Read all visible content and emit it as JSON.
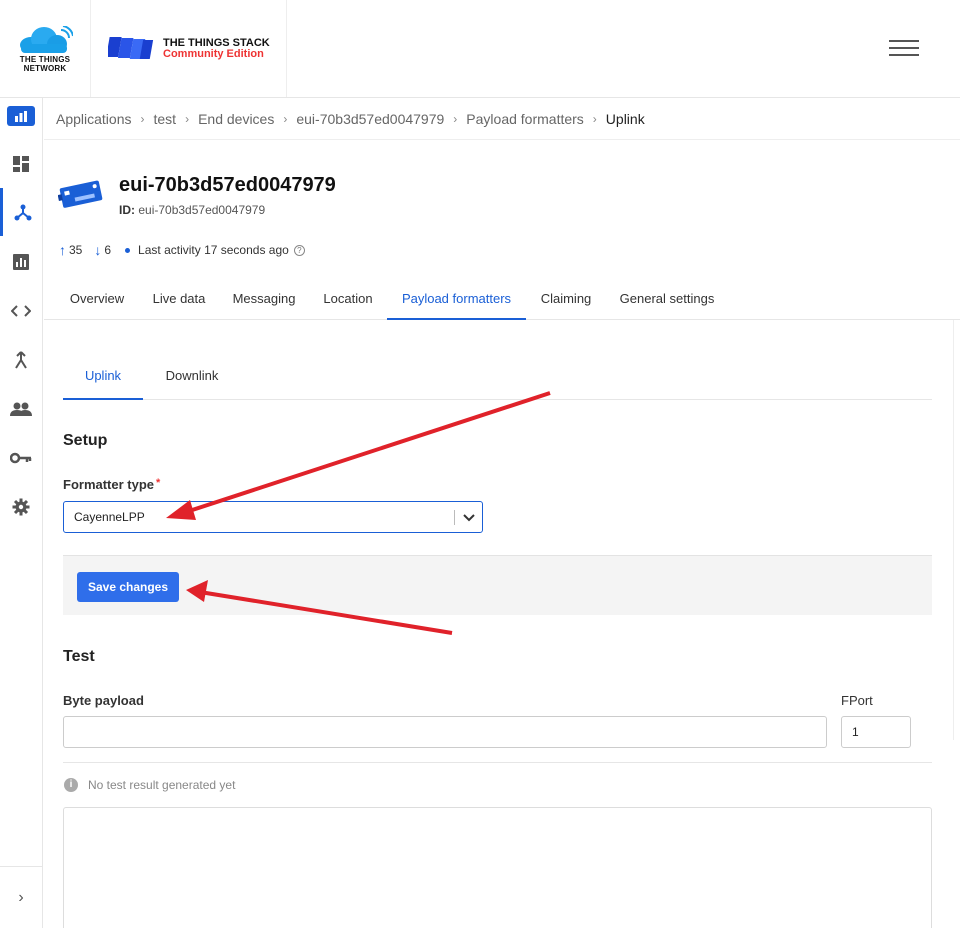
{
  "header": {
    "ttn_logo_text": [
      "THE THINGS",
      "NETWORK"
    ],
    "product_title": "THE THINGS STACK",
    "product_edition": "Community Edition"
  },
  "sidebar": {
    "items": [
      {
        "icon": "dashboard-icon"
      },
      {
        "icon": "applications-icon",
        "active": true
      },
      {
        "icon": "chart-icon"
      },
      {
        "icon": "code-icon"
      },
      {
        "icon": "merge-icon"
      },
      {
        "icon": "people-icon"
      },
      {
        "icon": "key-icon"
      },
      {
        "icon": "gear-icon"
      }
    ],
    "collapse_label": "›"
  },
  "breadcrumb": [
    "Applications",
    "test",
    "End devices",
    "eui-70b3d57ed0047979",
    "Payload formatters",
    "Uplink"
  ],
  "device": {
    "title": "eui-70b3d57ed0047979",
    "id_label": "ID:",
    "id_value": "eui-70b3d57ed0047979",
    "uplink_count": "35",
    "downlink_count": "6",
    "last_activity": "Last activity 17 seconds ago"
  },
  "tabs": [
    "Overview",
    "Live data",
    "Messaging",
    "Location",
    "Payload formatters",
    "Claiming",
    "General settings"
  ],
  "active_tab": "Payload formatters",
  "subtabs": [
    "Uplink",
    "Downlink"
  ],
  "setup": {
    "title": "Setup",
    "formatter_label": "Formatter type",
    "required_mark": "*",
    "formatter_value": "CayenneLPP",
    "save_label": "Save changes"
  },
  "test": {
    "title": "Test",
    "byte_payload_label": "Byte payload",
    "byte_payload_value": "",
    "fport_label": "FPort",
    "fport_value": "1",
    "no_result_text": "No test result generated yet"
  },
  "colors": {
    "accent": "#1a5fd6",
    "button": "#2f6eea",
    "annotation_arrow": "#e0222a"
  }
}
